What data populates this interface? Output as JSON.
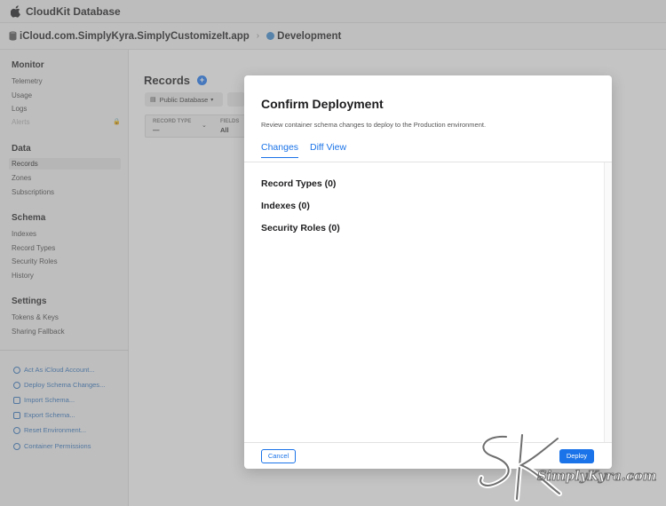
{
  "titlebar": {
    "app_title": "CloudKit Database"
  },
  "breadcrumb": {
    "container": "iCloud.com.SimplyKyra.SimplyCustomizeIt.app",
    "separator": "›",
    "environment": "Development"
  },
  "sidebar": {
    "monitor": {
      "heading": "Monitor",
      "items": [
        "Telemetry",
        "Usage",
        "Logs",
        "Alerts"
      ]
    },
    "data": {
      "heading": "Data",
      "items": [
        "Records",
        "Zones",
        "Subscriptions"
      ]
    },
    "schema": {
      "heading": "Schema",
      "items": [
        "Indexes",
        "Record Types",
        "Security Roles",
        "History"
      ]
    },
    "settings": {
      "heading": "Settings",
      "items": [
        "Tokens & Keys",
        "Sharing Fallback"
      ]
    },
    "actions": [
      "Act As iCloud Account...",
      "Deploy Schema Changes...",
      "Import Schema...",
      "Export Schema...",
      "Reset Environment...",
      "Container Permissions"
    ]
  },
  "main": {
    "title": "Records",
    "database_select": "Public Database",
    "filter": {
      "record_type_label": "RECORD TYPE",
      "record_type_value": "—",
      "fields_label": "FIELDS",
      "fields_value": "All"
    }
  },
  "modal": {
    "title": "Confirm Deployment",
    "subtitle": "Review container schema changes to deploy to the Production environment.",
    "tabs": [
      "Changes",
      "Diff View"
    ],
    "active_tab": "Changes",
    "changes": [
      "Record Types (0)",
      "Indexes (0)",
      "Security Roles (0)"
    ],
    "cancel_label": "Cancel",
    "deploy_label": "Deploy"
  },
  "watermark": {
    "text": "SimplyKyra.com"
  },
  "colors": {
    "accent": "#1a73e8",
    "environment_dot": "#3a86c8"
  }
}
